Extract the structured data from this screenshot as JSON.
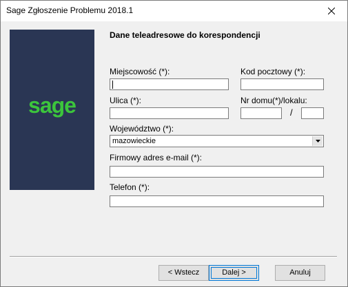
{
  "window": {
    "title": "Sage Zgłoszenie Problemu 2018.1"
  },
  "logo": {
    "text": "sage"
  },
  "form": {
    "heading": "Dane teleadresowe do korespondencji",
    "city_label": "Miejscowość (*):",
    "city_value": "",
    "postcode_label": "Kod pocztowy (*):",
    "postcode_value": "",
    "street_label": "Ulica (*):",
    "street_value": "",
    "house_label": "Nr domu(*)/lokalu:",
    "house_value": "",
    "house_separator": "/",
    "flat_value": "",
    "province_label": "Województwo (*):",
    "province_value": "mazowieckie",
    "email_label": "Firmowy adres e-mail (*):",
    "email_value": "",
    "phone_label": "Telefon (*):",
    "phone_value": ""
  },
  "buttons": {
    "back": "< Wstecz",
    "next": "Dalej >",
    "cancel": "Anuluj"
  },
  "colors": {
    "logo_panel": "#2a3654",
    "logo_text": "#3cc53c",
    "focus_border": "#0078d7"
  }
}
